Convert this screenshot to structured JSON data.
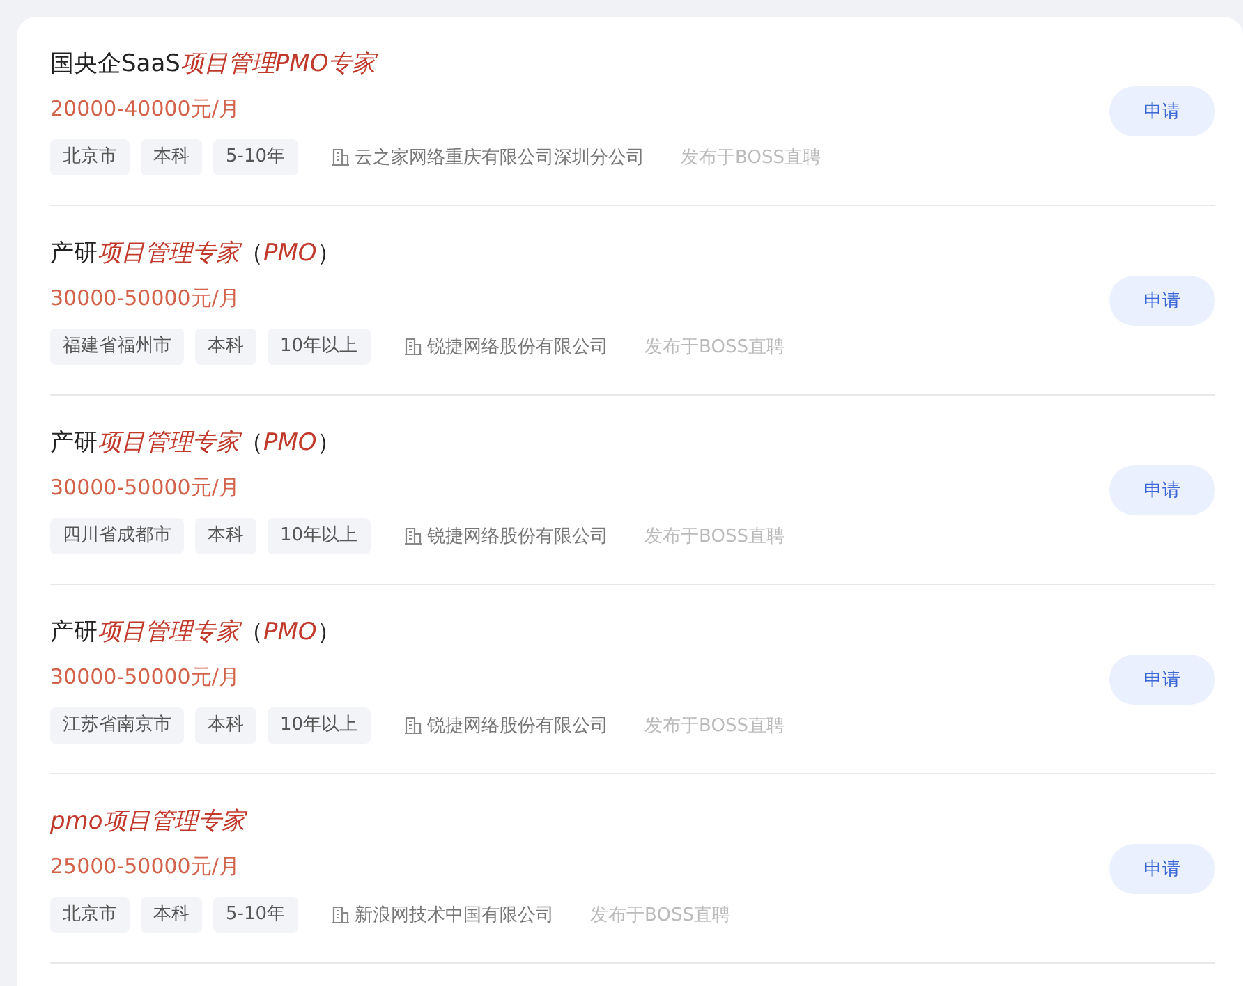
{
  "jobs": [
    {
      "title": [
        {
          "text": "国央企SaaS",
          "highlight": false
        },
        {
          "text": "项目管理PMO专家",
          "highlight": true
        }
      ],
      "salary": "20000-40000元/月",
      "tags": [
        "北京市",
        "本科",
        "5-10年"
      ],
      "company": "云之家网络重庆有限公司深圳分公司",
      "source": "发布于BOSS直聘",
      "button": "申请"
    },
    {
      "title": [
        {
          "text": "产研",
          "highlight": false
        },
        {
          "text": "项目管理专家",
          "highlight": true
        },
        {
          "text": "（",
          "highlight": false
        },
        {
          "text": "PMO",
          "highlight": true
        },
        {
          "text": "）",
          "highlight": false
        }
      ],
      "salary": "30000-50000元/月",
      "tags": [
        "福建省福州市",
        "本科",
        "10年以上"
      ],
      "company": "锐捷网络股份有限公司",
      "source": "发布于BOSS直聘",
      "button": "申请"
    },
    {
      "title": [
        {
          "text": "产研",
          "highlight": false
        },
        {
          "text": "项目管理专家",
          "highlight": true
        },
        {
          "text": "（",
          "highlight": false
        },
        {
          "text": "PMO",
          "highlight": true
        },
        {
          "text": "）",
          "highlight": false
        }
      ],
      "salary": "30000-50000元/月",
      "tags": [
        "四川省成都市",
        "本科",
        "10年以上"
      ],
      "company": "锐捷网络股份有限公司",
      "source": "发布于BOSS直聘",
      "button": "申请"
    },
    {
      "title": [
        {
          "text": "产研",
          "highlight": false
        },
        {
          "text": "项目管理专家",
          "highlight": true
        },
        {
          "text": "（",
          "highlight": false
        },
        {
          "text": "PMO",
          "highlight": true
        },
        {
          "text": "）",
          "highlight": false
        }
      ],
      "salary": "30000-50000元/月",
      "tags": [
        "江苏省南京市",
        "本科",
        "10年以上"
      ],
      "company": "锐捷网络股份有限公司",
      "source": "发布于BOSS直聘",
      "button": "申请"
    },
    {
      "title": [
        {
          "text": "pmo项目管理专家",
          "highlight": true
        }
      ],
      "salary": "25000-50000元/月",
      "tags": [
        "北京市",
        "本科",
        "5-10年"
      ],
      "company": "新浪网技术中国有限公司",
      "source": "发布于BOSS直聘",
      "button": "申请"
    }
  ]
}
